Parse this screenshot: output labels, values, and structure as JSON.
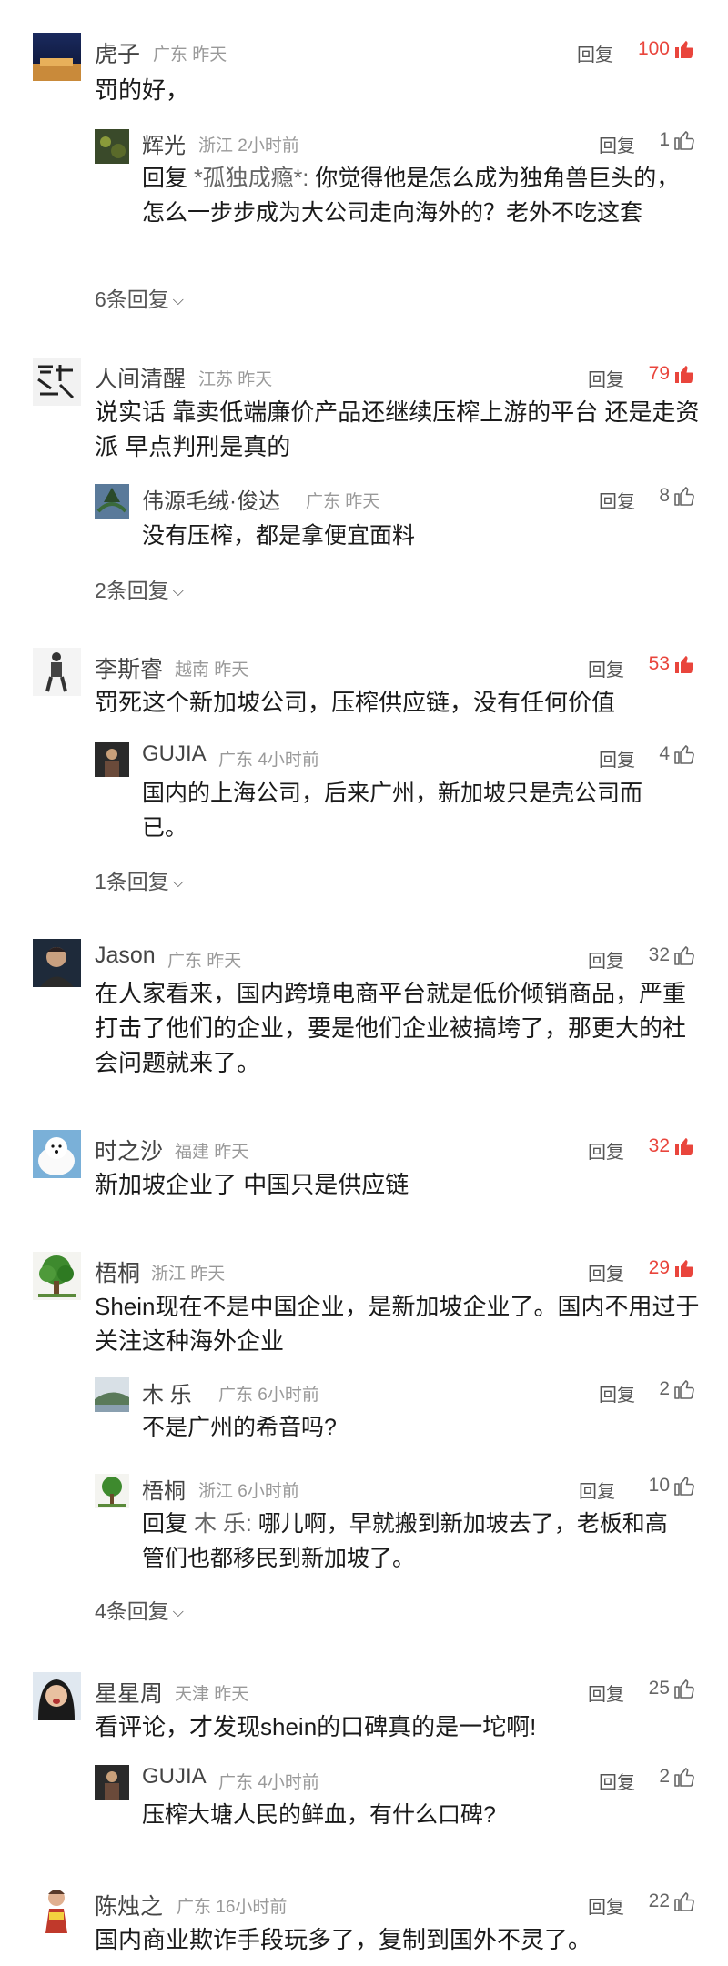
{
  "ui": {
    "reply_label": "回复"
  },
  "colors": {
    "hot_like": "#e9453c",
    "normal_like": "#666666"
  },
  "comments": [
    {
      "name": "虎子",
      "meta": "广东  昨天",
      "likes": "100",
      "hot": true,
      "text": "罚的好，",
      "replies": [
        {
          "name": "辉光",
          "meta": "浙江  2小时前",
          "likes": "1",
          "mention_prefix": "回复 ",
          "mention": "*孤独成瘾*:",
          "text": " 你觉得他是怎么成为独角兽巨头的，怎么一步步成为大公司走向海外的？老外不吃这套"
        }
      ],
      "more": "6条回复"
    },
    {
      "name": "人间清醒",
      "meta": "江苏  昨天",
      "likes": "79",
      "hot": true,
      "text": "说实话 靠卖低端廉价产品还继续压榨上游的平台 还是走资派 早点判刑是真的",
      "replies": [
        {
          "name": "伟源毛绒·俊达",
          "meta": "广东  昨天",
          "likes": "8",
          "text": "没有压榨，都是拿便宜面料"
        }
      ],
      "more": "2条回复"
    },
    {
      "name": "李斯睿",
      "meta": "越南  昨天",
      "likes": "53",
      "hot": true,
      "text": "罚死这个新加坡公司，压榨供应链，没有任何价值",
      "replies": [
        {
          "name": "GUJIA",
          "meta": "广东  4小时前",
          "likes": "4",
          "text": "国内的上海公司，后来广州，新加坡只是壳公司而已。"
        }
      ],
      "more": "1条回复"
    },
    {
      "name": "Jason",
      "meta": "广东  昨天",
      "likes": "32",
      "hot": false,
      "text": "在人家看来，国内跨境电商平台就是低价倾销商品，严重打击了他们的企业，要是他们企业被搞垮了，那更大的社会问题就来了。"
    },
    {
      "name": "时之沙",
      "meta": "福建  昨天",
      "likes": "32",
      "hot": true,
      "text": "新加坡企业了 中国只是供应链"
    },
    {
      "name": "梧桐",
      "meta": "浙江  昨天",
      "likes": "29",
      "hot": true,
      "text": "Shein现在不是中国企业，是新加坡企业了。国内不用过于关注这种海外企业",
      "replies": [
        {
          "name": "木  乐",
          "meta": "广东  6小时前",
          "likes": "2",
          "text": "不是广州的希音吗?"
        },
        {
          "name": "梧桐",
          "meta": "浙江  6小时前",
          "likes": "10",
          "mention_prefix": "回复 ",
          "mention": "木  乐:",
          "text": " 哪儿啊，早就搬到新加坡去了，老板和高管们也都移民到新加坡了。"
        }
      ],
      "more": "4条回复"
    },
    {
      "name": "星星周",
      "meta": "天津  昨天",
      "likes": "25",
      "hot": false,
      "text": "看评论，才发现shein的口碑真的是一坨啊!",
      "replies": [
        {
          "name": "GUJIA",
          "meta": "广东  4小时前",
          "likes": "2",
          "text": "压榨大塘人民的鲜血，有什么口碑?"
        }
      ]
    },
    {
      "name": "陈烛之",
      "meta": "广东  16小时前",
      "likes": "22",
      "hot": false,
      "text": "国内商业欺诈手段玩多了，复制到国外不灵了。"
    }
  ]
}
